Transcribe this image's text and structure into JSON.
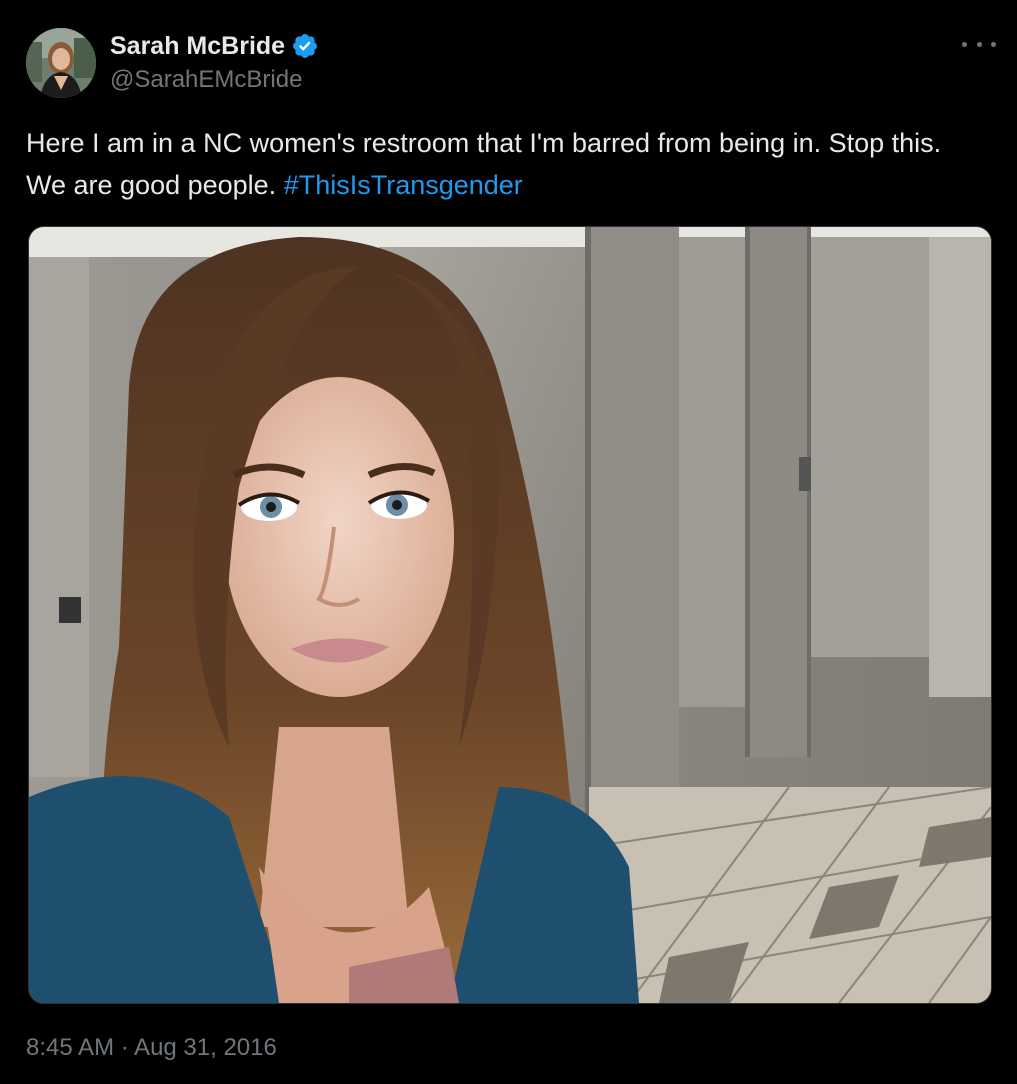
{
  "author": {
    "display_name": "Sarah McBride",
    "handle": "@SarahEMcBride",
    "verified": true,
    "avatar_icon": "profile-photo"
  },
  "tweet": {
    "text": "Here I am in a NC women's restroom that I'm barred from being in. Stop this. We are good people. ",
    "hashtag": "#ThisIsTransgender",
    "timestamp": "8:45 AM · Aug 31, 2016",
    "media": {
      "type": "photo",
      "description": "selfie-in-restroom"
    }
  },
  "icons": {
    "more": "more-options-icon",
    "verified": "verified-badge-icon"
  },
  "colors": {
    "background": "#000000",
    "text_primary": "#e7e9ea",
    "text_secondary": "#71767b",
    "link": "#1d9bf0",
    "verified": "#1d9bf0"
  }
}
